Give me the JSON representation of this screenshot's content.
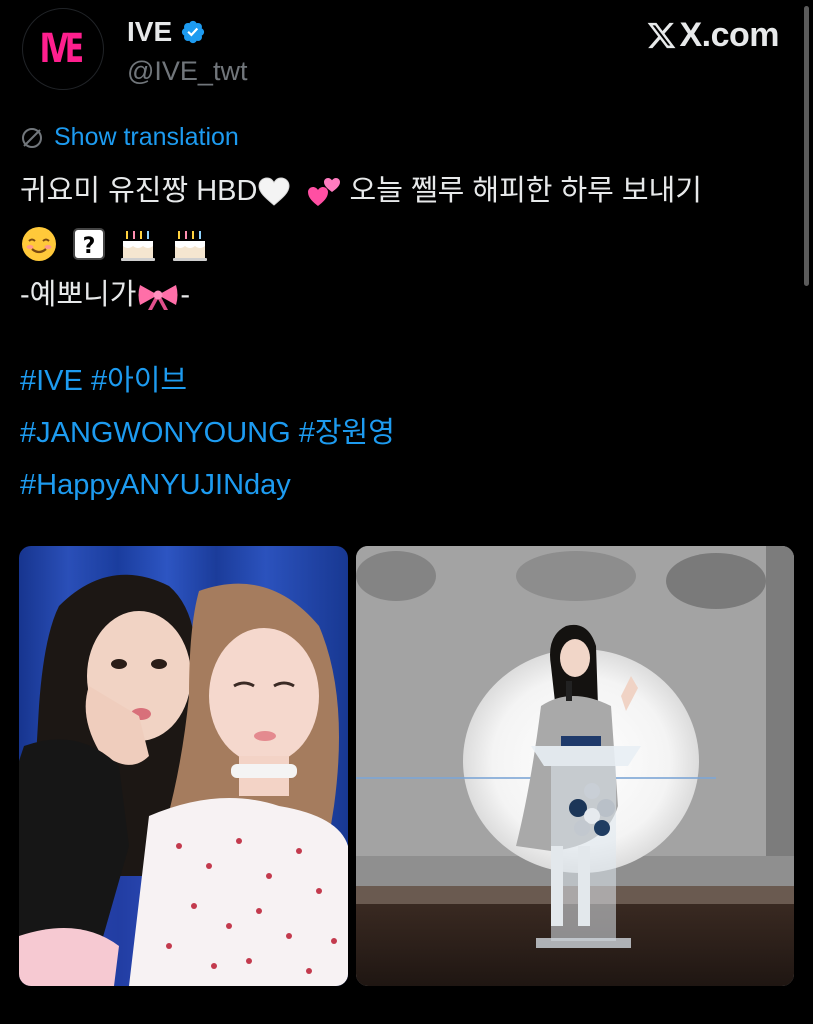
{
  "account": {
    "display_name": "IVE",
    "handle": "@IVE_twt",
    "avatar_text": "IVE",
    "verified": true
  },
  "site": {
    "label": "X.com"
  },
  "translation": {
    "label": "Show translation"
  },
  "tweet": {
    "line1_text": "귀요미 유진짱 HBD",
    "line1_text2": " 오늘 쩰루 해피한 하루 보내기",
    "line3_prefix": "-예뽀니가",
    "line3_suffix": "-",
    "emojis": [
      "white-heart",
      "two-hearts",
      "smiling-face",
      "question-mark-box",
      "birthday-cake",
      "birthday-cake",
      "ribbon"
    ],
    "hashtags": [
      [
        "#IVE",
        "#아이브"
      ],
      [
        "#JANGWONYOUNG",
        "#장원영"
      ],
      [
        "#HappyANYUJINday"
      ]
    ]
  },
  "media": [
    {
      "type": "photo",
      "name": "selfie-two-members"
    },
    {
      "type": "photo",
      "name": "member-speaking-at-podium"
    }
  ],
  "colors": {
    "background": "#000000",
    "text": "#e7e9ea",
    "secondary": "#71767b",
    "link": "#1d9bf0",
    "brand": "#ff1f8e"
  }
}
